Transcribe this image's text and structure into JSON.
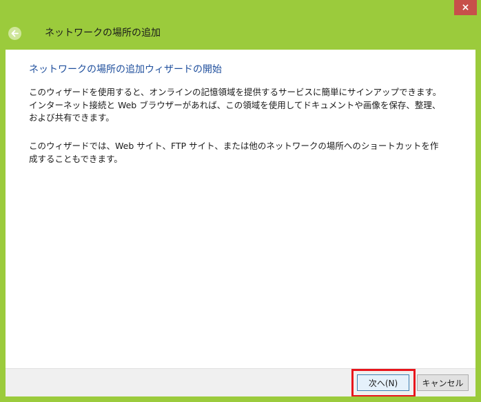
{
  "window": {
    "title": "ネットワークの場所の追加",
    "close_icon": "×"
  },
  "content": {
    "heading": "ネットワークの場所の追加ウィザードの開始",
    "paragraph1_line1": "このウィザードを使用すると、オンラインの記憶領域を提供するサービスに簡単にサインアップできます。",
    "paragraph1_line2": "インターネット接続と Web ブラウザーがあれば、この領域を使用してドキュメントや画像を保存、整理、",
    "paragraph1_line3": "および共有できます。",
    "paragraph2_line1": "このウィザードでは、Web サイト、FTP サイト、または他のネットワークの場所へのショートカットを作",
    "paragraph2_line2": "成することもできます。"
  },
  "footer": {
    "next_label": "次へ(N)",
    "cancel_label": "キャンセル"
  },
  "colors": {
    "frame": "#9bcb3c",
    "heading": "#1e4e9c",
    "highlight": "#e8141b",
    "close": "#c7504a"
  }
}
